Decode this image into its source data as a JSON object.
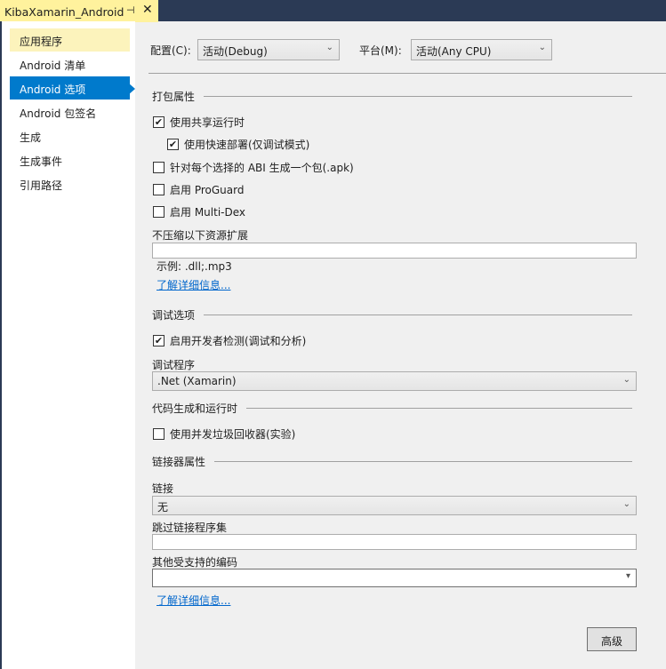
{
  "tab": {
    "title": "KibaXamarin_Android",
    "pin": "⊣",
    "close": "✕"
  },
  "sidebar": {
    "items": [
      {
        "label": "应用程序"
      },
      {
        "label": "Android 清单"
      },
      {
        "label": "Android 选项"
      },
      {
        "label": "Android 包签名"
      },
      {
        "label": "生成"
      },
      {
        "label": "生成事件"
      },
      {
        "label": "引用路径"
      }
    ]
  },
  "config": {
    "label": "配置(C):",
    "value": "活动(Debug)"
  },
  "platform": {
    "label": "平台(M):",
    "value": "活动(Any CPU)"
  },
  "packaging": {
    "title": "打包属性",
    "shared_runtime": "使用共享运行时",
    "fast_deploy": "使用快速部署(仅调试模式)",
    "per_abi": "针对每个选择的 ABI 生成一个包(.apk)",
    "proguard": "启用 ProGuard",
    "multidex": "启用 Multi-Dex",
    "no_compress_label": "不压缩以下资源扩展",
    "no_compress_value": "",
    "example": "示例: .dll;.mp3",
    "learn_more": "了解详细信息..."
  },
  "debug": {
    "title": "调试选项",
    "dev_instrumentation": "启用开发者检测(调试和分析)",
    "debugger_label": "调试程序",
    "debugger_value": ".Net (Xamarin)"
  },
  "codegen": {
    "title": "代码生成和运行时",
    "concurrent_gc": "使用并发垃圾回收器(实验)"
  },
  "linker": {
    "title": "链接器属性",
    "link_label": "链接",
    "link_value": "无",
    "skip_label": "跳过链接程序集",
    "skip_value": "",
    "encodings_label": "其他受支持的编码",
    "encodings_value": "",
    "learn_more": "了解详细信息..."
  },
  "advanced_button": "高级",
  "checks": {
    "shared_runtime": true,
    "fast_deploy": true,
    "per_abi": false,
    "proguard": false,
    "multidex": false,
    "dev_instrumentation": true,
    "concurrent_gc": false
  }
}
